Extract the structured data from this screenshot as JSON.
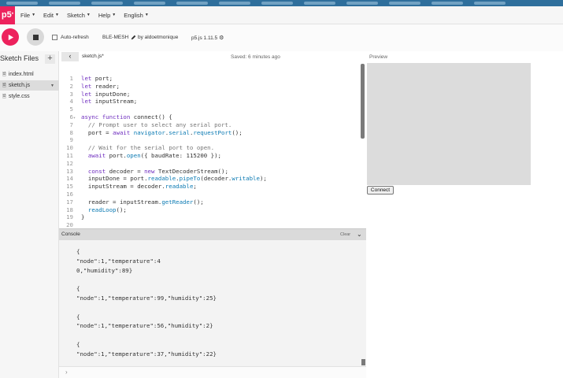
{
  "navbar": {
    "logo": "p5",
    "logo_mark": "*",
    "menu": [
      {
        "label": "File"
      },
      {
        "label": "Edit"
      },
      {
        "label": "Sketch"
      },
      {
        "label": "Help"
      },
      {
        "label": "English"
      }
    ]
  },
  "toolbar": {
    "autorefresh_label": "Auto-refresh",
    "project_name": "BLE-MESH",
    "byline": "by aldoetmonique",
    "version": "p5.js 1.11.5"
  },
  "sidebar": {
    "title": "Sketch Files",
    "add_label": "+",
    "files": [
      {
        "name": "index.html",
        "selected": false
      },
      {
        "name": "sketch.js",
        "selected": true
      },
      {
        "name": "style.css",
        "selected": false
      }
    ]
  },
  "editor": {
    "tab_name": "sketch.js*",
    "saved_status": "Saved: 6 minutes ago",
    "lines": [
      {
        "num": "1",
        "text": "let port;"
      },
      {
        "num": "2",
        "text": "let reader;"
      },
      {
        "num": "3",
        "text": "let inputDone;"
      },
      {
        "num": "4",
        "text": "let inputStream;"
      },
      {
        "num": "5",
        "text": ""
      },
      {
        "num": "6",
        "text": "async function connect() {"
      },
      {
        "num": "7",
        "text": "  // Prompt user to select any serial port."
      },
      {
        "num": "8",
        "text": "  port = await navigator.serial.requestPort();"
      },
      {
        "num": "9",
        "text": ""
      },
      {
        "num": "10",
        "text": "  // Wait for the serial port to open."
      },
      {
        "num": "11",
        "text": "  await port.open({ baudRate: 115200 });"
      },
      {
        "num": "12",
        "text": ""
      },
      {
        "num": "13",
        "text": "  const decoder = new TextDecoderStream();"
      },
      {
        "num": "14",
        "text": "  inputDone = port.readable.pipeTo(decoder.writable);"
      },
      {
        "num": "15",
        "text": "  inputStream = decoder.readable;"
      },
      {
        "num": "16",
        "text": ""
      },
      {
        "num": "17",
        "text": "  reader = inputStream.getReader();"
      },
      {
        "num": "18",
        "text": "  readLoop();"
      },
      {
        "num": "19",
        "text": "}"
      },
      {
        "num": "20",
        "text": ""
      }
    ]
  },
  "console": {
    "title": "Console",
    "clear_label": "Clear",
    "lines": [
      "{",
      "\"node\":1,\"temperature\":4",
      "0,\"humidity\":89}",
      "",
      "{",
      "\"node\":1,\"temperature\":99,\"humidity\":25}",
      "",
      "{",
      "\"node\":1,\"temperature\":56,\"humidity\":2}",
      "",
      "{",
      "\"node\":1,\"temperature\":37,\"humidity\":22}"
    ],
    "prompt": "›"
  },
  "preview": {
    "label": "Preview",
    "connect_label": "Connect"
  },
  "colors": {
    "accent": "#ed225d",
    "keyword": "#6f2ebf",
    "function": "#0b7ab3",
    "comment": "#777777"
  }
}
